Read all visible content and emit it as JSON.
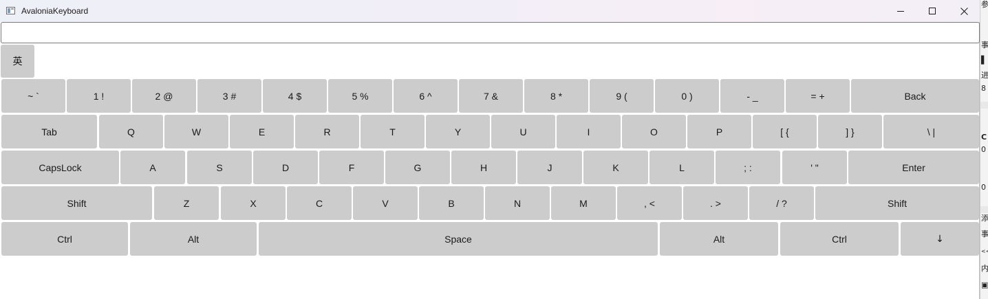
{
  "window": {
    "title": "AvaloniaKeyboard",
    "controls": {
      "minimize": "minimize",
      "maximize": "maximize",
      "close": "close"
    }
  },
  "input": {
    "value": "",
    "placeholder": ""
  },
  "language_button": {
    "label": "英"
  },
  "keyboard": {
    "rows": [
      [
        "~ `",
        "1 !",
        "2 @",
        "3 #",
        "4 $",
        "5 %",
        "6 ^",
        "7 &",
        "8 *",
        "9 (",
        "0 )",
        "- _",
        "= +",
        "Back"
      ],
      [
        "Tab",
        "Q",
        "W",
        "E",
        "R",
        "T",
        "Y",
        "U",
        "I",
        "O",
        "P",
        "[ {",
        "] }",
        "\\ |"
      ],
      [
        "CapsLock",
        "A",
        "S",
        "D",
        "F",
        "G",
        "H",
        "J",
        "K",
        "L",
        "; :",
        "' \"",
        "Enter"
      ],
      [
        "Shift",
        "Z",
        "X",
        "C",
        "V",
        "B",
        "N",
        "M",
        ", <",
        ". >",
        "/ ?",
        "Shift"
      ],
      [
        "Ctrl",
        "Alt",
        "Space",
        "Alt",
        "Ctrl",
        "↓"
      ]
    ]
  },
  "background_window": {
    "glyphs": [
      "参",
      "事",
      "▌",
      "进",
      "8",
      "C",
      "0",
      "0",
      "添",
      "事",
      "<<",
      "内",
      "▣"
    ]
  },
  "colors": {
    "key_background": "#cccccc",
    "text": "#1a1a1a",
    "window_background": "#ffffff"
  }
}
